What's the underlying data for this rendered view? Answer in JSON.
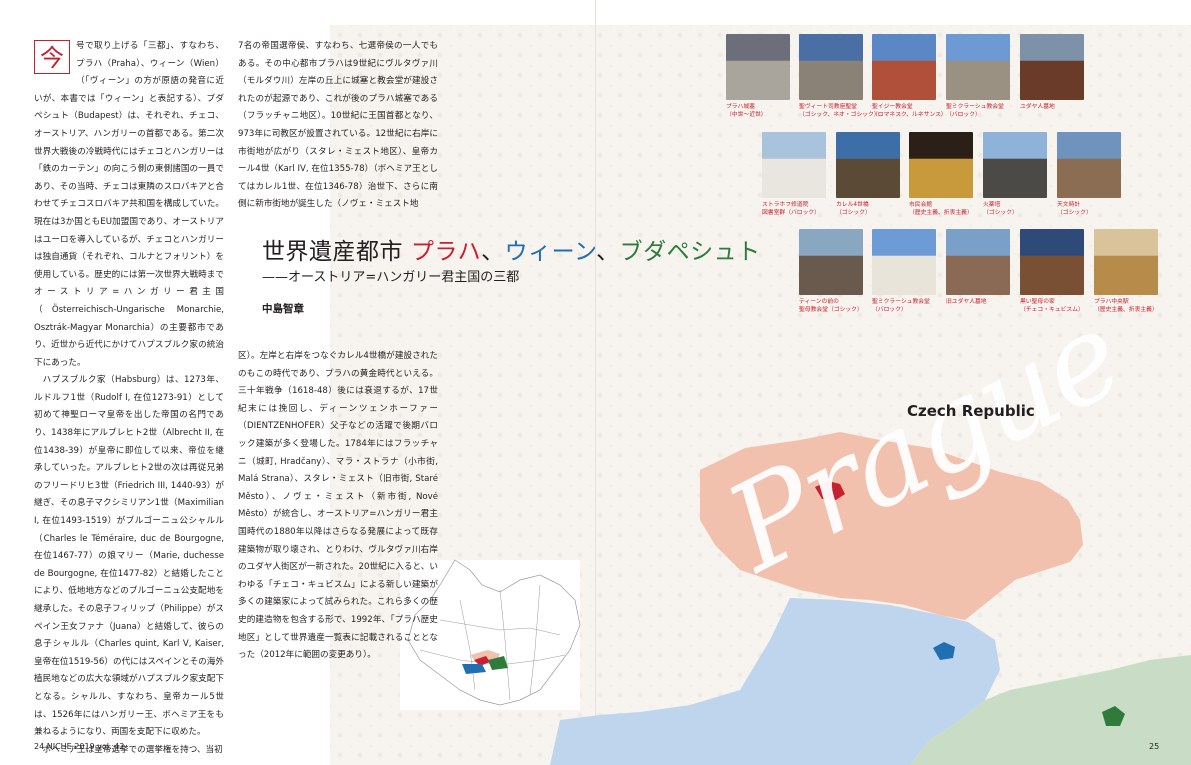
{
  "article": {
    "dropcap": "今",
    "title_prefix": "世界遺産都市 ",
    "title_prague": "プラハ",
    "title_sep1": "、",
    "title_vienna": "ウィーン",
    "title_sep2": "、",
    "title_budapest": "ブダペシュト",
    "subtitle": "——オーストリア=ハンガリー君主国の三都",
    "author": "中島智章"
  },
  "left_col": {
    "p1": "号で取り上げる「三都」、すなわち、プラハ（Praha）、ウィーン（Wien）（「ヴィーン」の方が原語の発音に近いが、本書では「ウィーン」と表記する）、ブダペシュト（Budapest）は、それぞれ、チェコ、オーストリア、ハンガリーの首都である。第二次世界大戦後の冷戦時代にはチェコとハンガリーは「鉄のカーテン」の向こう側の東側諸国の一員であり、その当時、チェコは東隣のスロバキアと合わせてチェコスロバキア共和国を構成していた。現在は3か国ともEU加盟国であり、オーストリアはユーロを導入しているが、チェコとハンガリーは独自通貨（それぞれ、コルナとフォリント）を使用している。歴史的には第一次世界大戦時までオーストリア=ハンガリー君主国（Österreichisch-Ungarische Monarchie, Osztrák-Magyar Monarchia）の主要都市であり、近世から近代にかけてハプスブルク家の統治下にあった。",
    "p2": "ハプスブルク家（Habsburg）は、1273年、ルドルフ1世（Rudolf I, 在位1273-91）として初めて神聖ローマ皇帝を出した帝国の名門であり、1438年にアルブレヒト2世（Albrecht II, 在位1438-39）が皇帝に即位して以来、帝位を継承していった。アルブレヒト2世の次は再従兄弟のフリードリヒ3世（Friedrich III, 1440-93）が継ぎ、その息子マクシミリアン1世（Maximilian I, 在位1493-1519）がブルゴーニュ公シャルル（Charles le Téméraire, duc de Bourgogne, 在位1467-77）の娘マリー（Marie, duchesse de Bourgogne, 在位1477-82）と結婚したことにより、低地地方などのブルゴーニュ公支配地を継承した。その息子フィリップ（Philippe）がスペイン王女ファナ（Juana）と結婚して、彼らの息子シャルル（Charles quint, Karl V, Kaiser, 皇帝在位1519-56）の代にはスペインとその海外植民地などの広大な領域がハプスブルク家支配下となる。シャルル、すなわち、皇帝カール5世は、1526年にはハンガリー王、ボヘミア王をも兼ねるようになり、両国を支配下に収めた。",
    "p3": "ボヘミア王は皇帝選挙での選挙権を持つ、当初"
  },
  "mid_col_top": {
    "p1": "7名の帝国選帝侯、すなわち、七選帝侯の一人でもある。その中心都市プラハは9世紀にヴルタヴァ川（モルダウ川）左岸の丘上に城塞と教会堂が建設されたのが起源であり、これが後のプラハ城塞である（フラッチャニ地区）。10世紀に王国首都となり、973年に司教区が設置されている。12世紀に右岸に市街地が広がり（スタレ・ミェスト地区）、皇帝カール4世（Karl IV, 在位1355-78）（ボヘミア王としてはカレル1世、在位1346-78）治世下、さらに南側に新市街地が誕生した（ノヴェ・ミェスト地"
  },
  "mid_col_bottom": {
    "p1": "区）。左岸と右岸をつなぐカレル4世橋が建設されたのもこの時代であり、プラハの黄金時代といえる。三十年戦争（1618-48）後には衰退するが、17世紀末には挽回し、ディーンツェンホーファー（DIENTZENHOFER）父子などの活躍で後期バロック建築が多く登場した。1784年にはフラッチャニ（城町, Hradčany）、マラ・ストラナ（小市街, Malá Strana）、スタレ・ミェスト（旧市街, Staré Město）、ノヴェ・ミェスト（新市街, Nové Město）が統合し、オーストリア=ハンガリー君主国時代の1880年以降はさらなる発展によって既存建築物が取り壊され、とりわけ、ヴルタヴァ川右岸のユダヤ人街区が一新された。20世紀に入ると、いわゆる「チェコ・キュビスム」による新しい建築が多くの建築家によって試みられた。これら多くの歴史的建造物を包含する形で、1992年、「プラハ歴史地区」として世界遺産一覧表に記載されることとなった（2012年に範囲の変更あり）。"
  },
  "thumbs": [
    {
      "name": "プラハ城塞",
      "style": "（中世〜近世）",
      "colors": [
        "#6c6f7a",
        "#a9a59d"
      ]
    },
    {
      "name": "聖ヴィート司教座聖堂",
      "style": "（ゴシック、ネオ・ゴシック）",
      "colors": [
        "#4a6fa5",
        "#8a8276"
      ]
    },
    {
      "name": "聖イジー教会堂",
      "style": "（ロマネスク、ルネサンス）",
      "colors": [
        "#5b87c4",
        "#b0503b"
      ]
    },
    {
      "name": "聖ミクラーシュ教会堂",
      "style": "（バロック）",
      "colors": [
        "#6d9ad3",
        "#9a9183"
      ]
    },
    {
      "name": "ユダヤ人墓地",
      "style": "",
      "colors": [
        "#7d92a8",
        "#6b3b2a"
      ]
    },
    {
      "name": "ストラホフ修道院",
      "style": "図書室群（バロック）",
      "colors": [
        "#a9c3dc",
        "#e9e6df"
      ]
    },
    {
      "name": "カレル4世橋",
      "style": "（ゴシック）",
      "colors": [
        "#3d6ea8",
        "#5b4a36"
      ]
    },
    {
      "name": "市民会館",
      "style": "（歴史主義、折衷主義）",
      "colors": [
        "#2a2018",
        "#c89a3c"
      ]
    },
    {
      "name": "火薬塔",
      "style": "（ゴシック）",
      "colors": [
        "#8eb2d8",
        "#4b4a47"
      ]
    },
    {
      "name": "天文時計",
      "style": "（ゴシック）",
      "colors": [
        "#6e93bd",
        "#8a6d52"
      ]
    },
    {
      "name": "ティーンの前の",
      "style": "聖母教会堂（ゴシック）",
      "colors": [
        "#8aa7c2",
        "#6a5a4d"
      ]
    },
    {
      "name": "聖ミクラーシュ教会堂",
      "style": "（バロック）",
      "colors": [
        "#6c9bd6",
        "#e8e4da"
      ]
    },
    {
      "name": "旧ユダヤ人墓地",
      "style": "",
      "colors": [
        "#7aa0c8",
        "#8a6a55"
      ]
    },
    {
      "name": "黒い聖母の家",
      "style": "（チェコ・キュビスム）",
      "colors": [
        "#2d4a78",
        "#7a5034"
      ]
    },
    {
      "name": "プラハ中央駅",
      "style": "（歴史主義、折衷主義）",
      "colors": [
        "#d9c39a",
        "#b78b4a"
      ]
    }
  ],
  "map": {
    "country": "Czech Republic",
    "city_script": "Prague",
    "colors": {
      "czech": "#f2c1ae",
      "austria": "#bfd5ee",
      "hungary": "#c9ddc6",
      "prague": "#c8202f",
      "vienna": "#1f6fb2",
      "budapest": "#2f7b3b"
    }
  },
  "folio": {
    "left": "24   NICHE 2019 vol. 42",
    "right": "25"
  }
}
